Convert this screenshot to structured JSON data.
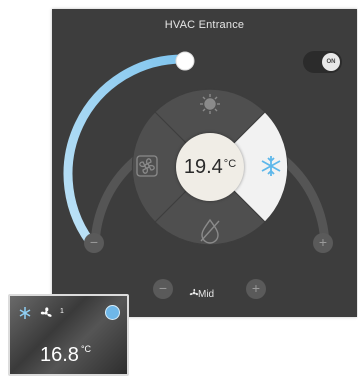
{
  "panel": {
    "title": "HVAC Entrance",
    "power_toggle": {
      "label": "ON",
      "state": "on"
    },
    "setpoint": {
      "value": "19.4",
      "unit": "°C",
      "fill_fraction": 0.48
    },
    "modes": [
      {
        "name": "heat",
        "icon": "sun-icon",
        "selected": false
      },
      {
        "name": "cool",
        "icon": "snowflake-icon",
        "selected": true
      },
      {
        "name": "dry",
        "icon": "droplet-icon",
        "selected": false
      },
      {
        "name": "fan",
        "icon": "fan-icon",
        "selected": false
      }
    ],
    "decrease_temp": {
      "label": "−"
    },
    "increase_temp": {
      "label": "+"
    },
    "fan_speed": {
      "label": "Mid",
      "decrease": "−",
      "increase": "+"
    },
    "colors": {
      "panel_bg": "#3d3d3d",
      "arc_fill": "#a9d6f0",
      "cool_accent": "#5db7ea"
    }
  },
  "thumbnail": {
    "fan_count": "1",
    "temperature": "16.8",
    "unit": "°C",
    "status_color": "#6fb7e8"
  }
}
